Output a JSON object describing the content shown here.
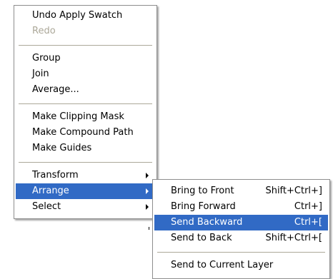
{
  "colors": {
    "highlight": "#316ac5",
    "disabled_text": "#aca899",
    "menu_border": "#8e8e8e"
  },
  "context_menu": {
    "undo": "Undo Apply Swatch",
    "redo": "Redo",
    "group": "Group",
    "join": "Join",
    "average": "Average...",
    "make_clipping_mask": "Make Clipping Mask",
    "make_compound_path": "Make Compound Path",
    "make_guides": "Make Guides",
    "transform": "Transform",
    "arrange": "Arrange",
    "select": "Select"
  },
  "arrange_submenu": {
    "bring_to_front": {
      "label": "Bring to Front",
      "shortcut": "Shift+Ctrl+]"
    },
    "bring_forward": {
      "label": "Bring Forward",
      "shortcut": "Ctrl+]"
    },
    "send_backward": {
      "label": "Send Backward",
      "shortcut": "Ctrl+["
    },
    "send_to_back": {
      "label": "Send to Back",
      "shortcut": "Shift+Ctrl+["
    },
    "send_to_current_layer": {
      "label": "Send to Current Layer"
    }
  }
}
